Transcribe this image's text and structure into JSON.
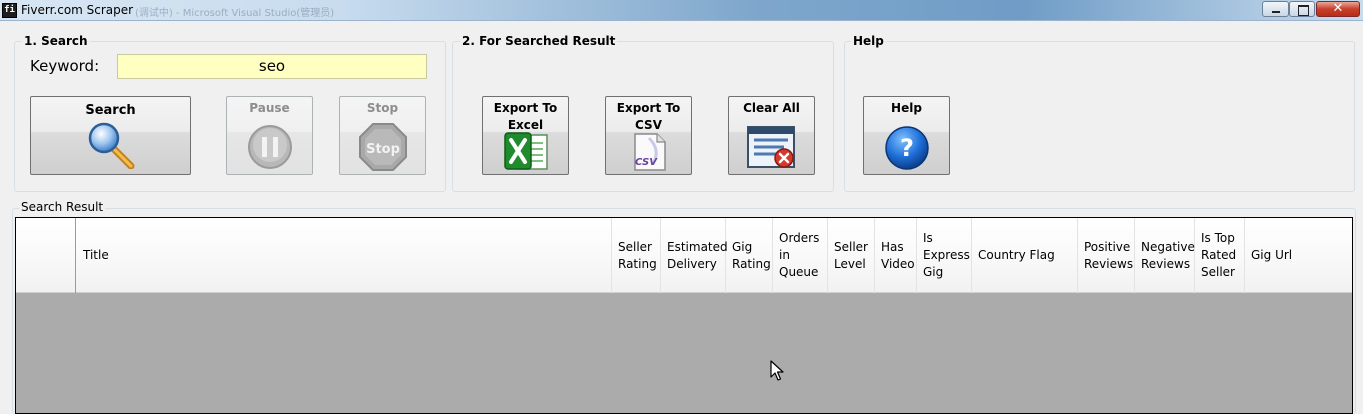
{
  "window": {
    "title": "Fiverr.com Scraper",
    "title_ghost": "(调试中) - Microsoft Visual Studio(管理员)",
    "icon_text": "fi"
  },
  "search_group": {
    "title": "1. Search",
    "keyword_label": "Keyword:",
    "keyword_value": "seo",
    "buttons": {
      "search": "Search",
      "pause": "Pause",
      "stop": "Stop"
    },
    "stop_icon_text": "Stop"
  },
  "result_group": {
    "title": "2.  For Searched Result",
    "buttons": {
      "export_excel": "Export To Excel",
      "export_csv": "Export To CSV",
      "clear_all": "Clear All"
    },
    "csv_icon_text": "CSV"
  },
  "help_group": {
    "title": "Help",
    "help_button": "Help",
    "help_icon_text": "?"
  },
  "search_result": {
    "title": "Search Result",
    "columns": [
      "Title",
      "Seller Rating",
      "Estimated Delivery",
      "Gig Rating",
      "Orders in Queue",
      "Seller Level",
      "Has Video",
      "Is Express Gig",
      "Country Flag",
      "Positive Reviews",
      "Negative Reviews",
      "Is Top Rated Seller",
      "Gig Url"
    ]
  },
  "colors": {
    "keyword_bg": "#ffffc1",
    "grid_empty_bg": "#ababab"
  }
}
